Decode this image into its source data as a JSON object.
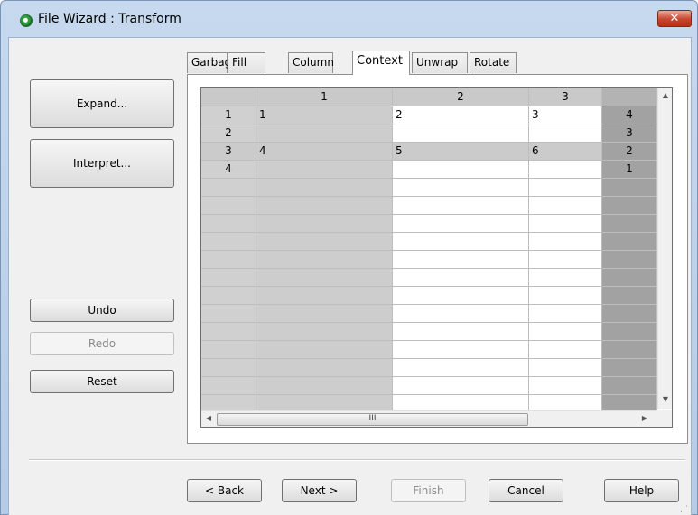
{
  "window": {
    "title": "File Wizard : Transform",
    "close_label": "✕"
  },
  "tabs": [
    {
      "label": "Garbage"
    },
    {
      "label": "Fill"
    },
    {
      "label": "Column"
    },
    {
      "label": "Context"
    },
    {
      "label": "Unwrap"
    },
    {
      "label": "Rotate"
    }
  ],
  "active_tab": "Context",
  "left_buttons": {
    "expand": "Expand...",
    "interpret": "Interpret...",
    "undo": "Undo",
    "redo": "Redo",
    "reset": "Reset"
  },
  "grid": {
    "column_headers": [
      "1",
      "2",
      "3"
    ],
    "rows": [
      {
        "header": "1",
        "cells": [
          "1",
          "2",
          "3"
        ],
        "extra": "4"
      },
      {
        "header": "2",
        "cells": [
          "",
          "",
          ""
        ],
        "extra": "3"
      },
      {
        "header": "3",
        "cells": [
          "4",
          "5",
          "6"
        ],
        "extra": "2"
      },
      {
        "header": "4",
        "cells": [
          "",
          "",
          ""
        ],
        "extra": "1"
      }
    ],
    "hscroll_thumb": "III"
  },
  "footer_buttons": {
    "back": "< Back",
    "next": "Next >",
    "finish": "Finish",
    "cancel": "Cancel",
    "help": "Help"
  }
}
